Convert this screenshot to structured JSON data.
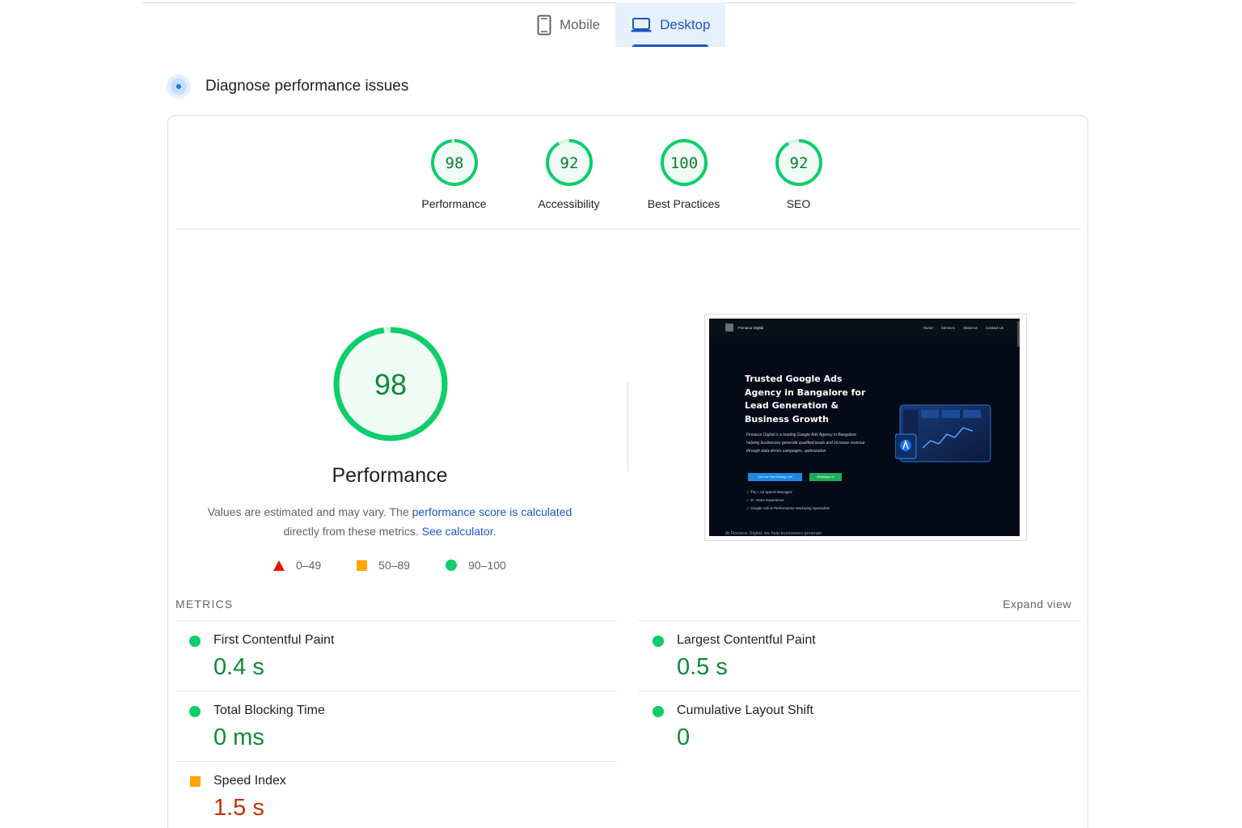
{
  "tabs": [
    {
      "label": "Mobile",
      "icon": "phone-icon",
      "active": false
    },
    {
      "label": "Desktop",
      "icon": "laptop-icon",
      "active": true
    }
  ],
  "section": {
    "title": "Diagnose performance issues",
    "icon": "diagnose-icon"
  },
  "categories": [
    {
      "score": "98",
      "label": "Performance",
      "fraction": 0.98
    },
    {
      "score": "92",
      "label": "Accessibility",
      "fraction": 0.92
    },
    {
      "score": "100",
      "label": "Best Practices",
      "fraction": 1.0
    },
    {
      "score": "92",
      "label": "SEO",
      "fraction": 0.92
    }
  ],
  "performance": {
    "score": "98",
    "fraction": 0.98,
    "title": "Performance",
    "desc_prefix": "Values are estimated and may vary. The ",
    "desc_link": "performance score is calculated",
    "desc_mid": " directly from these metrics. ",
    "desc_link2": "See calculator."
  },
  "legend": [
    {
      "range": "0–49",
      "shape": "triangle",
      "color": "#eb0f00"
    },
    {
      "range": "50–89",
      "shape": "square",
      "color": "#ffa400"
    },
    {
      "range": "90–100",
      "shape": "circle",
      "color": "#0cce6b"
    }
  ],
  "screenshot": {
    "brand": "Finnacor Digital",
    "nav_links": [
      "Home",
      "Services",
      "About us",
      "Contact Us"
    ],
    "headline": "Trusted Google Ads Agency in Bangalore for Lead Generation & Business Growth",
    "paragraph": "Finnacor Digital is a leading Google Ads Agency in Bangalore helping businesses generate qualified leads and increase revenue through data-driven campaigns, optimization.",
    "button1": "Get Your Free Strategy Call",
    "button2": "WhatsApp Us",
    "checks": [
      "✓ ₹5L+ Ad Spend Managed",
      "✓ 5+ Years Experience",
      "✓ Google Ads & Performance Marketing Specialists"
    ],
    "footer_text": "At Finnacor Digital, we help businesses generate"
  },
  "metrics": {
    "heading": "METRICS",
    "expand_label": "Expand view",
    "items": [
      {
        "name": "First Contentful Paint",
        "value": "0.4 s",
        "rating": "good"
      },
      {
        "name": "Largest Contentful Paint",
        "value": "0.5 s",
        "rating": "good"
      },
      {
        "name": "Total Blocking Time",
        "value": "0 ms",
        "rating": "good"
      },
      {
        "name": "Cumulative Layout Shift",
        "value": "0",
        "rating": "good"
      },
      {
        "name": "Speed Index",
        "value": "1.5 s",
        "rating": "average"
      }
    ]
  },
  "colors": {
    "pass": "#0cce6b",
    "pass_text": "#0c8a34",
    "average": "#ffa400",
    "average_text": "#c33300",
    "fail": "#eb0f00",
    "accent": "#1a56c2"
  }
}
